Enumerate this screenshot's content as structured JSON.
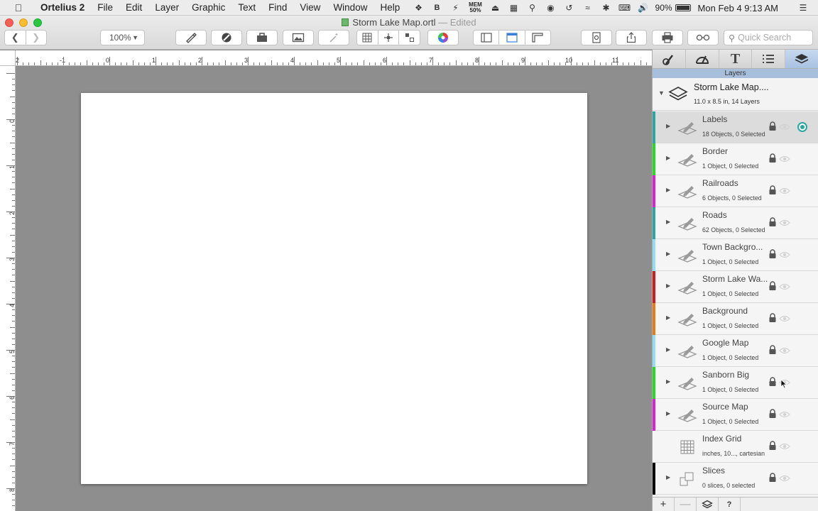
{
  "menubar": {
    "app_name": "Ortelius 2",
    "menus": [
      "File",
      "Edit",
      "Layer",
      "Graphic",
      "Text",
      "Find",
      "View",
      "Window",
      "Help"
    ],
    "mem_label": "MEM",
    "mem_value": "50%",
    "battery": "90%",
    "clock": "Mon Feb 4  9:13 AM"
  },
  "window": {
    "title": "Storm Lake Map.ortl",
    "title_suffix": "— Edited"
  },
  "toolbar": {
    "zoom": "100%",
    "search_placeholder": "Quick Search"
  },
  "rulers": {
    "horizontal_labels": [
      "2",
      "-1",
      "0",
      "1",
      "2",
      "3",
      "4",
      "5",
      "6",
      "7",
      "8",
      "9",
      "10",
      "11"
    ],
    "vertical_labels": [
      "0",
      "1",
      "2",
      "3",
      "4",
      "5",
      "6",
      "7",
      "8"
    ]
  },
  "inspector": {
    "tab_header": "Layers",
    "document": {
      "name": "Storm Lake Map....",
      "info": "11.0 x 8.5 in, 14 Layers"
    },
    "layers": [
      {
        "name": "Labels",
        "info": "18 Objects, 0 Selected",
        "color": "#2aa8a0",
        "selected": true
      },
      {
        "name": "Border",
        "info": "1 Object, 0 Selected",
        "color": "#22dd22"
      },
      {
        "name": "Railroads",
        "info": "6 Objects, 0 Selected",
        "color": "#e020d8"
      },
      {
        "name": "Roads",
        "info": "62 Objects, 0 Selected",
        "color": "#2aa8a0"
      },
      {
        "name": "Town Backgro...",
        "info": "1 Object, 0 Selected",
        "color": "#8fdff0"
      },
      {
        "name": "Storm Lake Wa...",
        "info": "1 Object, 0 Selected",
        "color": "#d61a1a"
      },
      {
        "name": "Background",
        "info": "1 Object, 0 Selected",
        "color": "#ee7a10"
      },
      {
        "name": "Google Map",
        "info": "1 Object, 0 Selected",
        "color": "#8fdff0"
      },
      {
        "name": "Sanborn Big",
        "info": "1 Object, 0 Selected",
        "color": "#22dd22"
      },
      {
        "name": "Source Map",
        "info": "1 Object, 0 Selected",
        "color": "#e020d8"
      },
      {
        "name": "Index Grid",
        "info": "inches, 10..., cartesian",
        "color": "",
        "grid": true
      },
      {
        "name": "Slices",
        "info": "0 slices, 0 selected",
        "color": "#000000",
        "slices": true
      }
    ],
    "bottom_buttons": {
      "add": "+",
      "remove": "—",
      "help": "?"
    }
  }
}
